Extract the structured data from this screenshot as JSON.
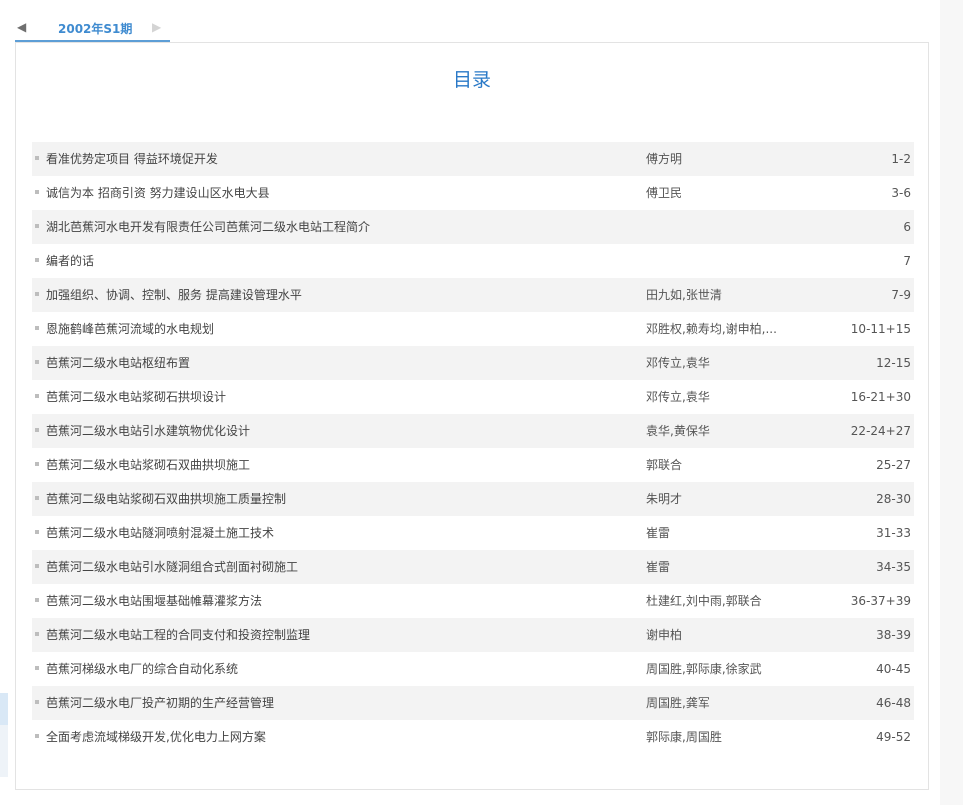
{
  "tab": {
    "label": "2002年S1期",
    "prev_icon": "◀",
    "next_icon": "▶"
  },
  "page_title": "目录",
  "toc": [
    {
      "title": "看准优势定项目 得益环境促开发",
      "author": "傅方明",
      "pages": "1-2"
    },
    {
      "title": "诚信为本 招商引资 努力建设山区水电大县",
      "author": "傅卫民",
      "pages": "3-6"
    },
    {
      "title": "湖北芭蕉河水电开发有限责任公司芭蕉河二级水电站工程简介",
      "author": "",
      "pages": "6"
    },
    {
      "title": "编者的话",
      "author": "",
      "pages": "7"
    },
    {
      "title": "加强组织、协调、控制、服务 提高建设管理水平",
      "author": "田九如,张世清",
      "pages": "7-9"
    },
    {
      "title": "恩施鹤峰芭蕉河流域的水电规划",
      "author": "邓胜权,赖寿均,谢申柏,...",
      "pages": "10-11+15"
    },
    {
      "title": "芭蕉河二级水电站枢纽布置",
      "author": "邓传立,袁华",
      "pages": "12-15"
    },
    {
      "title": "芭蕉河二级水电站浆砌石拱坝设计",
      "author": "邓传立,袁华",
      "pages": "16-21+30"
    },
    {
      "title": "芭蕉河二级水电站引水建筑物优化设计",
      "author": "袁华,黄保华",
      "pages": "22-24+27"
    },
    {
      "title": "芭蕉河二级水电站浆砌石双曲拱坝施工",
      "author": "郭联合",
      "pages": "25-27"
    },
    {
      "title": "芭蕉河二级电站浆砌石双曲拱坝施工质量控制",
      "author": "朱明才",
      "pages": "28-30"
    },
    {
      "title": "芭蕉河二级水电站隧洞喷射混凝土施工技术",
      "author": "崔雷",
      "pages": "31-33"
    },
    {
      "title": "芭蕉河二级水电站引水隧洞组合式剖面衬砌施工",
      "author": "崔雷",
      "pages": "34-35"
    },
    {
      "title": "芭蕉河二级水电站围堰基础帷幕灌浆方法",
      "author": "杜建红,刘中雨,郭联合",
      "pages": "36-37+39"
    },
    {
      "title": "芭蕉河二级水电站工程的合同支付和投资控制监理",
      "author": "谢申柏",
      "pages": "38-39"
    },
    {
      "title": "芭蕉河梯级水电厂的综合自动化系统",
      "author": "周国胜,郭际康,徐家武",
      "pages": "40-45"
    },
    {
      "title": "芭蕉河二级水电厂投产初期的生产经营管理",
      "author": "周国胜,龚军",
      "pages": "46-48"
    },
    {
      "title": "全面考虑流域梯级开发,优化电力上网方案",
      "author": "郭际康,周国胜",
      "pages": "49-52"
    }
  ]
}
